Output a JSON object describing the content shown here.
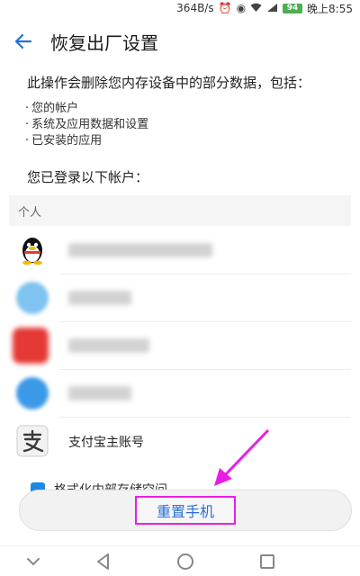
{
  "status_bar": {
    "net_speed": "364B/s",
    "battery": "94",
    "time": "晚上8:55"
  },
  "header": {
    "title": "恢复出厂设置"
  },
  "content": {
    "intro": "此操作会删除您内存设备中的部分数据，包括：",
    "bullets": [
      "您的帐户",
      "系统及应用数据和设置",
      "已安装的应用"
    ],
    "logged_in_label": "您已登录以下帐户："
  },
  "accounts": {
    "section_label": "个人",
    "alipay_label": "支付宝主账号",
    "partial_item": "格式化内部存储空间"
  },
  "reset_button": {
    "label": "重置手机"
  },
  "colors": {
    "accent_blue": "#2a6fd6",
    "annotation_magenta": "#e91ee6",
    "battery_green": "#4caf50"
  },
  "icons": {
    "back": "arrow-left-icon",
    "qq": "qq-penguin-icon",
    "alipay": "alipay-icon",
    "nav_down": "chevron-down-icon",
    "nav_back": "triangle-back-icon",
    "nav_home": "circle-home-icon",
    "nav_recent": "square-recent-icon"
  }
}
